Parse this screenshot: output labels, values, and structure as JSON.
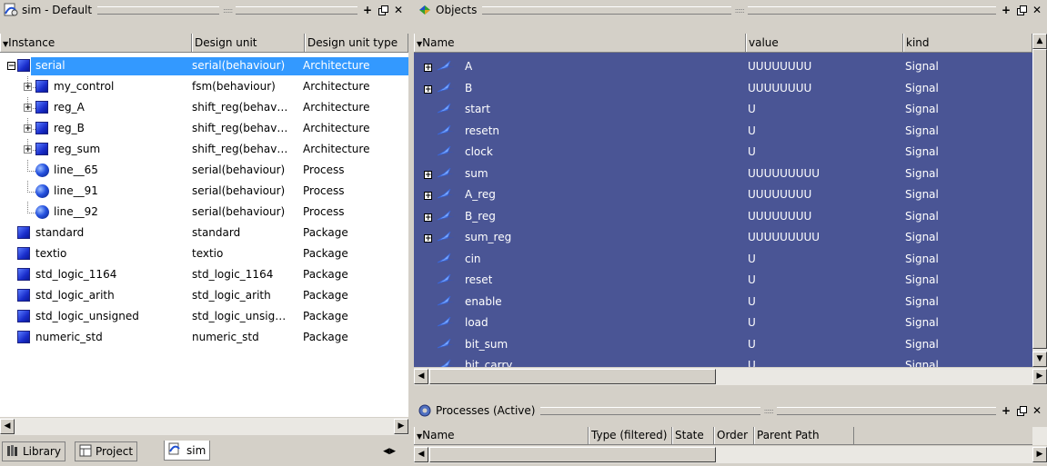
{
  "left_panel": {
    "title": "sim - Default",
    "columns": [
      "Instance",
      "Design unit",
      "Design unit type"
    ],
    "rows": [
      {
        "name": "serial",
        "unit": "serial(behaviour)",
        "type": "Architecture",
        "icon": "block-icon",
        "expander": "−",
        "selected": true,
        "indent": 0
      },
      {
        "name": "my_control",
        "unit": "fsm(behaviour)",
        "type": "Architecture",
        "icon": "block-icon",
        "expander": "+",
        "indent": 1
      },
      {
        "name": "reg_A",
        "unit": "shift_reg(behav…",
        "type": "Architecture",
        "icon": "block-icon",
        "expander": "+",
        "indent": 1
      },
      {
        "name": "reg_B",
        "unit": "shift_reg(behav…",
        "type": "Architecture",
        "icon": "block-icon",
        "expander": "+",
        "indent": 1
      },
      {
        "name": "reg_sum",
        "unit": "shift_reg(behav…",
        "type": "Architecture",
        "icon": "block-icon",
        "expander": "+",
        "indent": 1
      },
      {
        "name": "line__65",
        "unit": "serial(behaviour)",
        "type": "Process",
        "icon": "process-icon",
        "expander": "",
        "indent": 1
      },
      {
        "name": "line__91",
        "unit": "serial(behaviour)",
        "type": "Process",
        "icon": "process-icon",
        "expander": "",
        "indent": 1
      },
      {
        "name": "line__92",
        "unit": "serial(behaviour)",
        "type": "Process",
        "icon": "process-icon",
        "expander": "",
        "indent": 1
      },
      {
        "name": "standard",
        "unit": "standard",
        "type": "Package",
        "icon": "block-icon",
        "expander": "",
        "indent": 0
      },
      {
        "name": "textio",
        "unit": "textio",
        "type": "Package",
        "icon": "block-icon",
        "expander": "",
        "indent": 0
      },
      {
        "name": "std_logic_1164",
        "unit": "std_logic_1164",
        "type": "Package",
        "icon": "block-icon",
        "expander": "",
        "indent": 0
      },
      {
        "name": "std_logic_arith",
        "unit": "std_logic_arith",
        "type": "Package",
        "icon": "block-icon",
        "expander": "",
        "indent": 0
      },
      {
        "name": "std_logic_unsigned",
        "unit": "std_logic_unsig…",
        "type": "Package",
        "icon": "block-icon",
        "expander": "",
        "indent": 0
      },
      {
        "name": "numeric_std",
        "unit": "numeric_std",
        "type": "Package",
        "icon": "block-icon",
        "expander": "",
        "indent": 0
      }
    ],
    "tabs": [
      {
        "label": "Library",
        "icon": "library-icon"
      },
      {
        "label": "Project",
        "icon": "project-icon"
      },
      {
        "label": "sim",
        "icon": "sim-icon",
        "active": true
      }
    ]
  },
  "objects_panel": {
    "title": "Objects",
    "columns": [
      "Name",
      "value",
      "kind"
    ],
    "rows": [
      {
        "name": "A",
        "value": "UUUUUUUU",
        "kind": "Signal",
        "expander": "+"
      },
      {
        "name": "B",
        "value": "UUUUUUUU",
        "kind": "Signal",
        "expander": "+"
      },
      {
        "name": "start",
        "value": "U",
        "kind": "Signal",
        "expander": ""
      },
      {
        "name": "resetn",
        "value": "U",
        "kind": "Signal",
        "expander": ""
      },
      {
        "name": "clock",
        "value": "U",
        "kind": "Signal",
        "expander": ""
      },
      {
        "name": "sum",
        "value": "UUUUUUUUU",
        "kind": "Signal",
        "expander": "+"
      },
      {
        "name": "A_reg",
        "value": "UUUUUUUU",
        "kind": "Signal",
        "expander": "+"
      },
      {
        "name": "B_reg",
        "value": "UUUUUUUU",
        "kind": "Signal",
        "expander": "+"
      },
      {
        "name": "sum_reg",
        "value": "UUUUUUUUU",
        "kind": "Signal",
        "expander": "+"
      },
      {
        "name": "cin",
        "value": "U",
        "kind": "Signal",
        "expander": ""
      },
      {
        "name": "reset",
        "value": "U",
        "kind": "Signal",
        "expander": ""
      },
      {
        "name": "enable",
        "value": "U",
        "kind": "Signal",
        "expander": ""
      },
      {
        "name": "load",
        "value": "U",
        "kind": "Signal",
        "expander": ""
      },
      {
        "name": "bit_sum",
        "value": "U",
        "kind": "Signal",
        "expander": ""
      },
      {
        "name": "bit_carry",
        "value": "U",
        "kind": "Signal",
        "expander": ""
      }
    ]
  },
  "processes_panel": {
    "title": "Processes (Active)",
    "columns": [
      "Name",
      "Type (filtered)",
      "State",
      "Order",
      "Parent Path"
    ]
  },
  "colors": {
    "selection": "#3399ff",
    "objects_bg": "#4a5595",
    "chrome": "#d4d0c8"
  }
}
